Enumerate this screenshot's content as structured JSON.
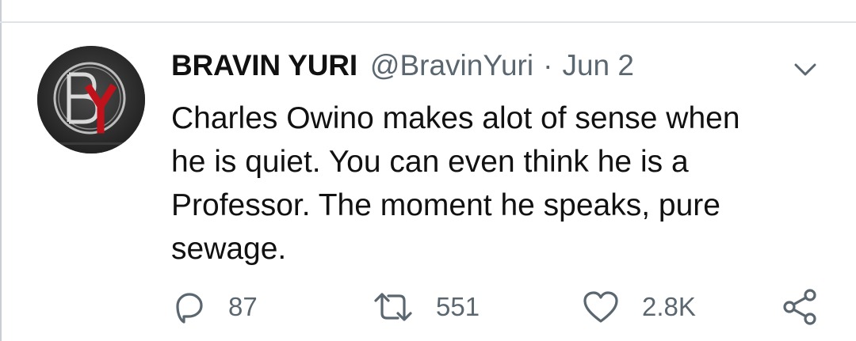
{
  "tweet": {
    "author_name": "BRAVIN YURI",
    "author_handle": "@BravinYuri",
    "separator": "·",
    "date": "Jun 2",
    "avatar_monogram": "BY",
    "avatar_caption": "BRAVIN YURI",
    "text_lines": [
      "Charles Owino makes alot of sense when",
      "he is quiet. You can even think he is a",
      "Professor. The moment he speaks, pure",
      "sewage."
    ]
  },
  "actions": {
    "reply": {
      "icon": "reply-icon",
      "count": "87"
    },
    "retweet": {
      "icon": "retweet-icon",
      "count": "551"
    },
    "like": {
      "icon": "heart-icon",
      "count": "2.8K"
    },
    "share": {
      "icon": "share-icon"
    }
  },
  "menu": {
    "icon": "chevron-down-icon"
  },
  "colors": {
    "text": "#111111",
    "secondary": "#5b6770",
    "avatar_red": "#c0121b",
    "avatar_bg": "#2a2a2a"
  }
}
